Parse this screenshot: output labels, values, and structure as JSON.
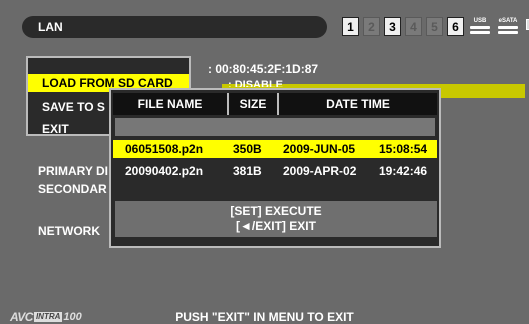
{
  "header": {
    "title": "LAN",
    "slots": [
      {
        "label": "1",
        "active": true
      },
      {
        "label": "2",
        "active": false
      },
      {
        "label": "3",
        "active": true
      },
      {
        "label": "4",
        "active": false
      },
      {
        "label": "5",
        "active": false
      },
      {
        "label": "6",
        "active": true
      }
    ],
    "usb_label": "USB",
    "esata_label": "eSATA",
    "icons": [
      "usb-icon",
      "esata-icon",
      "monitor-icon"
    ]
  },
  "background_menu": {
    "mac_address": ": 00:80:45:2F:1D:87",
    "disable_value": ": DISABLE",
    "labels": [
      "PRIMARY DI",
      "SECONDAR",
      "NETWORK"
    ]
  },
  "submenu": {
    "items": [
      {
        "label": "LOAD FROM SD CARD",
        "selected": true
      },
      {
        "label": "SAVE TO S",
        "selected": false
      },
      {
        "label": "EXIT",
        "selected": false
      }
    ]
  },
  "file_dialog": {
    "columns": [
      "FILE NAME",
      "SIZE",
      "DATE TIME"
    ],
    "rows": [
      {
        "name": "06051508.p2n",
        "size": "350B",
        "date": "2009-JUN-05",
        "time": "15:08:54",
        "selected": true
      },
      {
        "name": "20090402.p2n",
        "size": "381B",
        "date": "2009-APR-02",
        "time": "19:42:46",
        "selected": false
      }
    ],
    "footer_line1": "[SET] EXECUTE",
    "footer_line2": "[◄/EXIT] EXIT"
  },
  "footer": {
    "logo_avc": "AVC",
    "logo_intra": "INTRA",
    "logo_num": "100",
    "message": "PUSH \"EXIT\" IN MENU TO EXIT"
  },
  "colors": {
    "background": "#6a6a6a",
    "highlight": "#ffff00",
    "panel": "#2a2a2a"
  }
}
